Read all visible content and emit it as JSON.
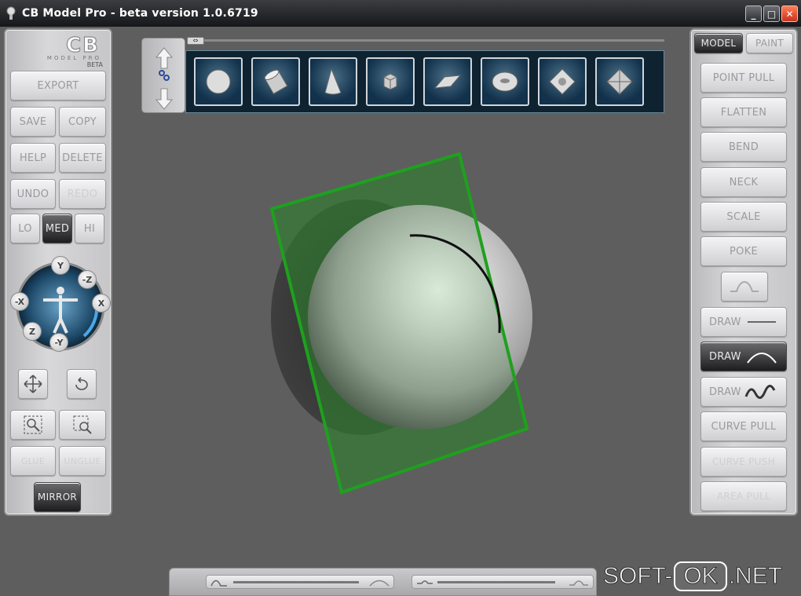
{
  "window": {
    "title": "CB Model Pro - beta version 1.0.6719",
    "minimize": "_",
    "maximize": "□",
    "close": "✕"
  },
  "logo": {
    "text": "CB",
    "sub": "MODEL PRO",
    "beta": "BETA"
  },
  "left_panel": {
    "export": "EXPORT",
    "save": "SAVE",
    "copy": "COPY",
    "help": "HELP",
    "delete": "DELETE",
    "undo": "UNDO",
    "redo": "REDO",
    "lo": "LO",
    "med": "MED",
    "hi": "HI",
    "glue": "GLUE",
    "unglue": "UNGLUE",
    "mirror": "MIRROR",
    "axes": {
      "y_pos": "Y",
      "z_neg": "-Z",
      "x_neg": "-X",
      "x_pos": "X",
      "z_pos": "Z",
      "y_neg": "-Y"
    }
  },
  "right_panel": {
    "tab_model": "MODEL",
    "tab_paint": "PAINT",
    "point_pull": "POINT PULL",
    "flatten": "FLATTEN",
    "bend": "BEND",
    "neck": "NECK",
    "scale": "SCALE",
    "poke": "POKE",
    "draw_line": "DRAW",
    "draw_arc": "DRAW",
    "draw_wave": "DRAW",
    "curve_pull": "CURVE PULL",
    "curve_push": "CURVE PUSH",
    "area_pull": "AREA PULL"
  },
  "shapes": [
    "sphere-icon",
    "cylinder-icon",
    "cone-icon",
    "cube-icon",
    "plane-icon",
    "torus-icon",
    "diamond-icon",
    "octahedron-icon"
  ],
  "watermark": {
    "left": "SOFT-",
    "mid": "OK",
    "right": ".NET"
  },
  "colors": {
    "accent_green": "#1fa01f",
    "panel": "#cfcfd1",
    "viewport": "#5e5e5e"
  }
}
